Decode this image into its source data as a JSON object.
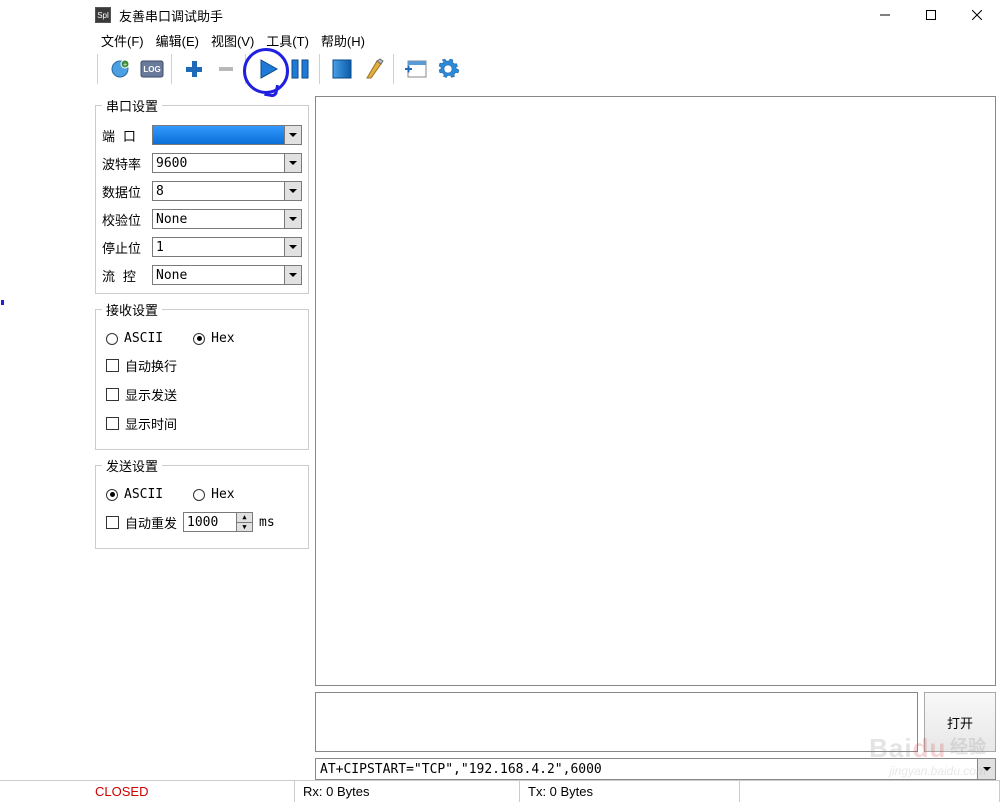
{
  "window": {
    "title": "友善串口调试助手"
  },
  "menu": {
    "file": "文件(F)",
    "edit": "编辑(E)",
    "view": "视图(V)",
    "tools": "工具(T)",
    "help": "帮助(H)"
  },
  "serial_settings": {
    "legend": "串口设置",
    "port_label": "端 口",
    "port_value": "",
    "baud_label": "波特率",
    "baud_value": "9600",
    "data_label": "数据位",
    "data_value": "8",
    "parity_label": "校验位",
    "parity_value": "None",
    "stop_label": "停止位",
    "stop_value": "1",
    "flow_label": "流 控",
    "flow_value": "None"
  },
  "receive_settings": {
    "legend": "接收设置",
    "ascii": "ASCII",
    "hex": "Hex",
    "auto_wrap": "自动换行",
    "show_send": "显示发送",
    "show_time": "显示时间"
  },
  "send_settings": {
    "legend": "发送设置",
    "ascii": "ASCII",
    "hex": "Hex",
    "auto_resend": "自动重发",
    "interval": "1000",
    "unit": "ms"
  },
  "buttons": {
    "open": "打开"
  },
  "command": {
    "value": "AT+CIPSTART=\"TCP\",\"192.168.4.2\",6000"
  },
  "status": {
    "closed": "CLOSED",
    "rx": "Rx: 0 Bytes",
    "tx": "Tx: 0 Bytes"
  },
  "watermark": {
    "brand": "Bai",
    "brand2": "du",
    "chn": "经验",
    "url": "jingyan.baidu.com"
  }
}
